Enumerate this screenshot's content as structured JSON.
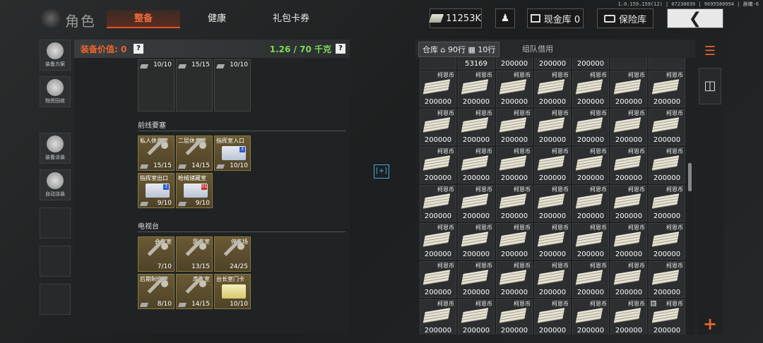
{
  "version": "1.0.159.159(12) | 07230039 | 9695580994 | 晨曦-6",
  "header": {
    "title": "角色",
    "tabs": [
      {
        "label": "整备",
        "active": true
      },
      {
        "label": "健康",
        "active": false
      },
      {
        "label": "礼包卡券",
        "active": false
      }
    ],
    "currency": "11253K",
    "cash_vault": "现金库 0",
    "safe_vault": "保险库",
    "back_icon": "chevron-left-icon"
  },
  "sidebar": [
    {
      "label": "装备方案",
      "icon": "soldier-gear-icon"
    },
    {
      "label": "物资回收",
      "icon": "recycle-icon"
    },
    {
      "label": "装备涂装",
      "icon": "helmet-paint-icon"
    },
    {
      "label": "自动涂装",
      "icon": "spray-icon"
    }
  ],
  "loadout": {
    "value_label": "装备价值: 0",
    "weight": "1.26 / 70 千克",
    "top_row_counts": [
      "10/10",
      "15/15",
      "10/10"
    ],
    "sections": [
      {
        "title": "前线要塞",
        "items": [
          {
            "name": "私人休息室",
            "count": "15/15",
            "type": "key"
          },
          {
            "name": "二层休息室",
            "count": "14/15",
            "type": "key"
          },
          {
            "name": "指挥室入口",
            "count": "10/10",
            "type": "card",
            "badge": "3"
          },
          {
            "name": "指挥室出口",
            "count": "9/10",
            "type": "card",
            "badge": "3"
          },
          {
            "name": "枪械储藏室",
            "count": "9/10",
            "type": "card-red",
            "badge": "01"
          }
        ]
      },
      {
        "title": "电视台",
        "items": [
          {
            "name": "会议室",
            "count": "7/10",
            "type": "key"
          },
          {
            "name": "医务室",
            "count": "13/15",
            "type": "key"
          },
          {
            "name": "停车场",
            "count": "24/25",
            "type": "key"
          },
          {
            "name": "后期制作室",
            "count": "8/10",
            "type": "key"
          },
          {
            "name": "库片室",
            "count": "14/15",
            "type": "key"
          },
          {
            "name": "台长室门卡",
            "count": "10/10",
            "type": "card-gold"
          }
        ]
      }
    ]
  },
  "storage": {
    "tab_label": "仓库",
    "rows_label": "90行",
    "rows2_label": "10行",
    "borrow_tab": "组队借用",
    "top_row": [
      "",
      "53169",
      "200000",
      "200000",
      "200000",
      ""
    ],
    "currency_name": "柯恩币",
    "cell_amount": "200000",
    "new_tag": "新"
  }
}
